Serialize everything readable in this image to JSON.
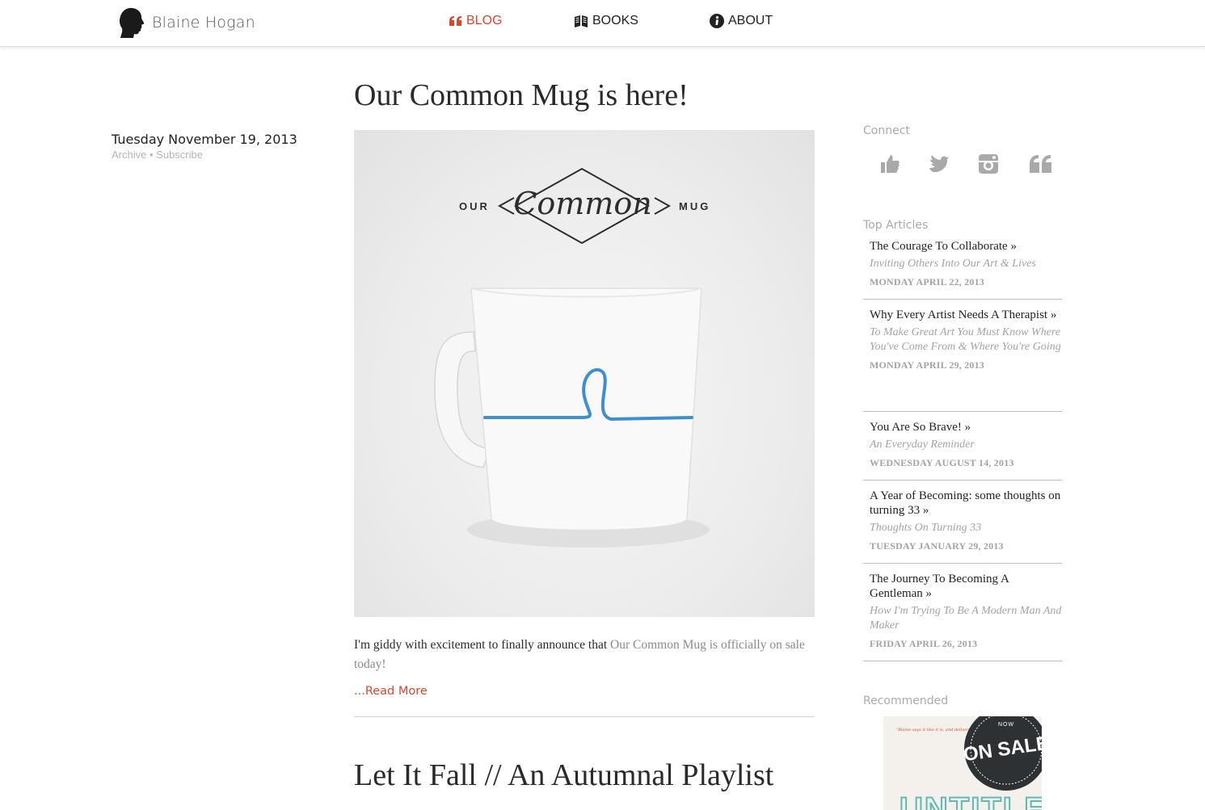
{
  "header": {
    "site_name": "Blaine Hogan",
    "nav": [
      {
        "label": "BLOG",
        "icon": "quote-icon",
        "active": true
      },
      {
        "label": "BOOKS",
        "icon": "book-icon",
        "active": false
      },
      {
        "label": "ABOUT",
        "icon": "info-icon",
        "active": false
      }
    ]
  },
  "post": {
    "title": "Our Common Mug is here!",
    "date": "Tuesday November 19, 2013",
    "archive_label": "Archive",
    "separator": "•",
    "subscribe_label": "Subscribe",
    "hero_logo": {
      "left": "OUR",
      "center": "Common",
      "right": "MUG"
    },
    "body_text": "I'm giddy with excitement to finally announce that ",
    "body_link": "Our Common Mug is officially on sale today!",
    "read_more": "...Read More"
  },
  "next_post": {
    "title": "Let It Fall // An Autumnal Playlist"
  },
  "sidebar": {
    "connect_heading": "Connect",
    "social": [
      "thumbs-up-icon",
      "twitter-bird-icon",
      "instagram-icon",
      "quote-icon"
    ],
    "top_heading": "Top Articles",
    "articles": [
      {
        "title": "The Courage To Collaborate »",
        "subtitle": "Inviting Others Into Our Art & Lives",
        "date": "MONDAY APRIL 22, 2013"
      },
      {
        "title": "Why Every Artist Needs A Therapist »",
        "subtitle": "To Make Great Art You Must Know Where You've Come From & Where You're Going",
        "date": "MONDAY APRIL 29, 2013"
      },
      {
        "title": "You Are So Brave! »",
        "subtitle": "An Everyday Reminder",
        "date": "WEDNESDAY AUGUST 14, 2013"
      },
      {
        "title": "A Year of Becoming: some thoughts on turning 33 »",
        "subtitle": "Thoughts On Turning 33",
        "date": "TUESDAY JANUARY 29, 2013"
      },
      {
        "title": "The Journey To Becoming A Gentleman »",
        "subtitle": "How I'm Trying To Be A Modern Man And Maker",
        "date": "FRIDAY APRIL 26, 2013"
      }
    ],
    "recommended_heading": "Recommended",
    "book": {
      "badge_top": "NOW",
      "badge": "ON SALE",
      "title_fragment": "UNTITLED",
      "blurb": "\"Blaine says it like it is, and delivers the goods.\""
    }
  },
  "colors": {
    "accent": "#d9472b",
    "muted": "#a3a3a3",
    "mug_line": "#3d8fd1",
    "badge": "#2e3133",
    "book_title": "#5fb9b3"
  }
}
